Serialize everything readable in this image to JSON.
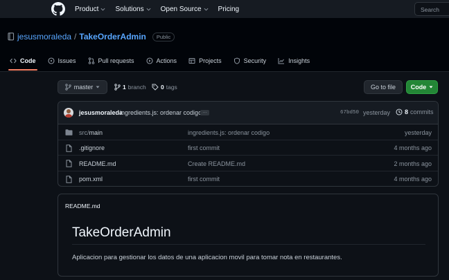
{
  "colors": {
    "accent": "#58a6ff",
    "active_tab": "#f78166",
    "code_button": "#238636",
    "bg": "#0d1117"
  },
  "nav": {
    "logo_icon": "github-mark-icon",
    "items": [
      {
        "label": "Product",
        "dropdown": true
      },
      {
        "label": "Solutions",
        "dropdown": true
      },
      {
        "label": "Open Source",
        "dropdown": true
      },
      {
        "label": "Pricing",
        "dropdown": false
      }
    ],
    "search_placeholder": "Search"
  },
  "repo": {
    "owner": "jesusmoraleda",
    "separator": "/",
    "name": "TakeOrderAdmin",
    "visibility": "Public"
  },
  "tabs": [
    {
      "label": "Code",
      "icon": "code-icon",
      "active": true
    },
    {
      "label": "Issues",
      "icon": "issue-icon"
    },
    {
      "label": "Pull requests",
      "icon": "pull-request-icon"
    },
    {
      "label": "Actions",
      "icon": "play-icon"
    },
    {
      "label": "Projects",
      "icon": "table-icon"
    },
    {
      "label": "Security",
      "icon": "shield-icon"
    },
    {
      "label": "Insights",
      "icon": "graph-icon"
    }
  ],
  "branch_bar": {
    "branch": "master",
    "branch_count": "1",
    "branch_label": "branch",
    "tag_count": "0",
    "tag_label": "tags",
    "goto_file": "Go to file",
    "code_button": "Code"
  },
  "last_commit": {
    "author": "jesusmoraleda",
    "message": "ingredients.js: ordenar codigo",
    "ellipsis": "…",
    "hash": "67bd50",
    "time": "yesterday",
    "count": "8",
    "count_label": "commits"
  },
  "files": [
    {
      "type": "folder",
      "name_prefix": "src/",
      "name": "main",
      "message": "ingredients.js: ordenar codigo",
      "date": "yesterday"
    },
    {
      "type": "file",
      "name_prefix": "",
      "name": ".gitignore",
      "message": "first commit",
      "date": "4 months ago"
    },
    {
      "type": "file",
      "name_prefix": "",
      "name": "README.md",
      "message": "Create README.md",
      "date": "2 months ago"
    },
    {
      "type": "file",
      "name_prefix": "",
      "name": "pom.xml",
      "message": "first commit",
      "date": "4 months ago"
    }
  ],
  "readme": {
    "filename": "README.md",
    "title": "TakeOrderAdmin",
    "body": "Aplicacion para gestionar los datos de una aplicacion movil para tomar nota en restaurantes."
  }
}
